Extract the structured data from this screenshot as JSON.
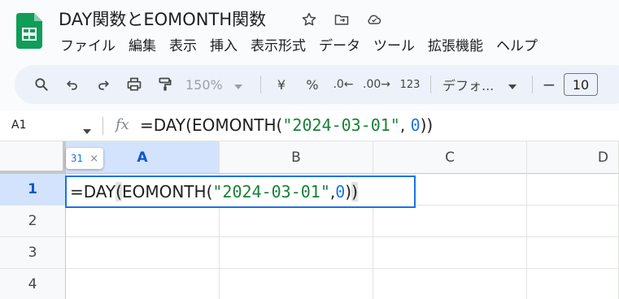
{
  "doc": {
    "title": "DAY関数とEOMONTH関数"
  },
  "menu": [
    "ファイル",
    "編集",
    "表示",
    "挿入",
    "表示形式",
    "データ",
    "ツール",
    "拡張機能",
    "ヘルプ"
  ],
  "toolbar": {
    "zoom": "150%",
    "currency": "¥",
    "percent": "%",
    "dec_decrease": ".0←",
    "dec_increase": ".00→",
    "number_format": "123",
    "font": "デフォ...",
    "minus": "−",
    "font_size": "10"
  },
  "formula_bar": {
    "name_box": "A1",
    "fx": "fx",
    "formula_prefix": "=DAY(EOMONTH(",
    "formula_string": "\"2024-03-01\"",
    "formula_sep": ", ",
    "formula_number": "0",
    "formula_suffix": "))"
  },
  "grid": {
    "columns": [
      "A",
      "B",
      "C",
      "D"
    ],
    "rows": [
      "1",
      "2",
      "3",
      "4"
    ],
    "active_column": "A",
    "active_row": "1"
  },
  "editor": {
    "prefix": "=DAY",
    "open_paren": "(",
    "middle": "EOMONTH(",
    "string": "\"2024-03-01\"",
    "sep": ", ",
    "number": "0",
    "inner_close": ")",
    "outer_close": ")"
  },
  "tooltip": {
    "value": "31",
    "close": "×"
  },
  "colors": {
    "accent": "#1a73e8",
    "header_active": "#d3e3fd",
    "string_green": "#188038",
    "sheets_green": "#0f9d58"
  }
}
